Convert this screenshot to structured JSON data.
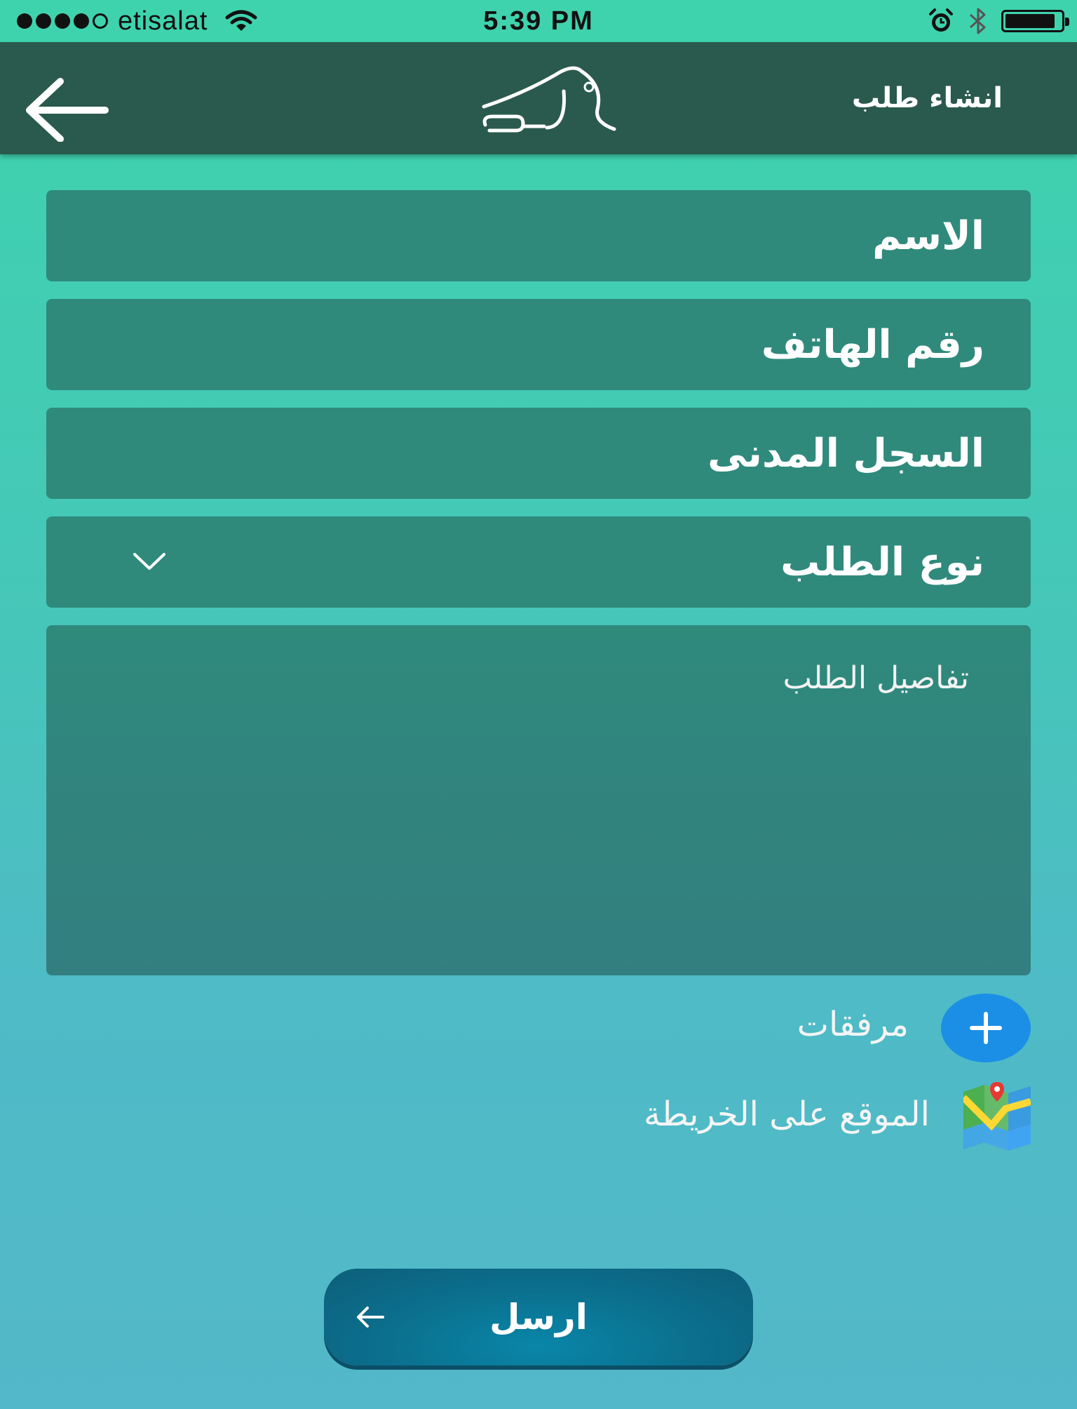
{
  "status_bar": {
    "carrier": "etisalat",
    "time": "5:39 PM",
    "signal_bars_filled": 4,
    "signal_bars_total": 5,
    "battery_level": 0.9,
    "icons": [
      "wifi-icon",
      "alarm-icon",
      "bluetooth-icon",
      "battery-icon"
    ]
  },
  "nav": {
    "title": "انشاء طلب",
    "logo_text": "راصد",
    "back_icon": "arrow-left-icon"
  },
  "form": {
    "name_placeholder": "الاسم",
    "phone_placeholder": "رقم الهاتف",
    "civil_id_placeholder": "السجل المدنى",
    "request_type_placeholder": "نوع الطلب",
    "details_placeholder": "تفاصيل الطلب"
  },
  "attachments": {
    "label": "مرفقات",
    "icon": "plus-icon"
  },
  "map": {
    "label": "الموقع على الخريطة",
    "icon": "map-icon"
  },
  "submit": {
    "label": "ارسل",
    "icon": "arrow-left-icon"
  },
  "colors": {
    "status_bar": "#3fd3ad",
    "nav_bar": "#2a5a4d",
    "field_bg": "#2f8a7c",
    "add_button": "#1b8fe5",
    "submit_button": "#0b6e8c"
  }
}
